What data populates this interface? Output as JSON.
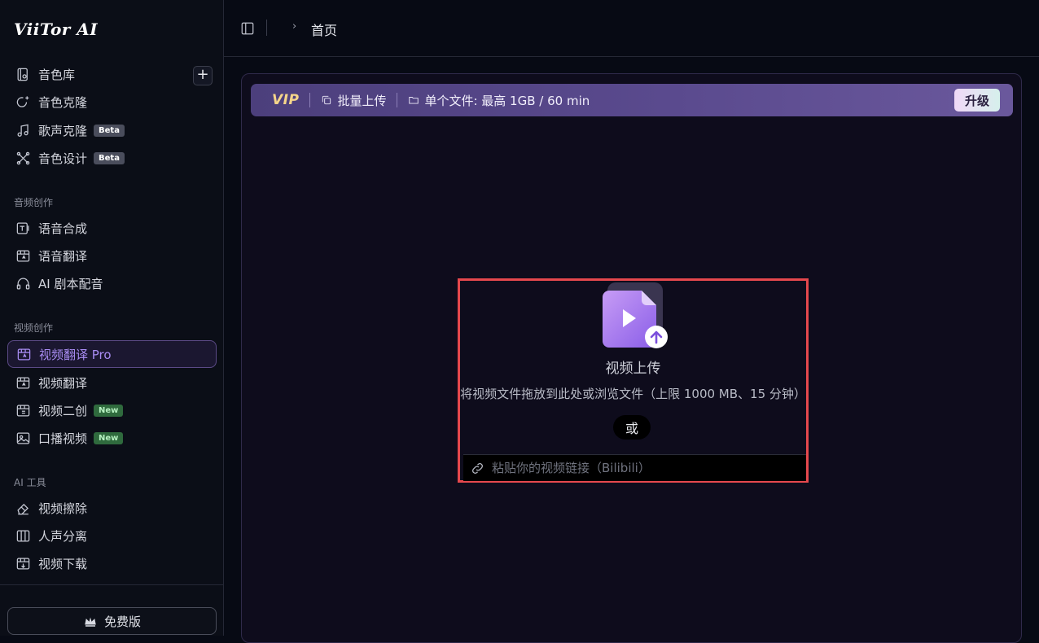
{
  "app": {
    "logo": "ViiTor AI"
  },
  "sidebar": {
    "top_items": [
      {
        "label": "音色库",
        "icon": "voice-library-icon"
      },
      {
        "label": "音色克隆",
        "icon": "voice-clone-icon"
      },
      {
        "label": "歌声克隆",
        "icon": "music-note-icon",
        "badge": "Beta"
      },
      {
        "label": "音色设计",
        "icon": "voice-design-icon",
        "badge": "Beta"
      }
    ],
    "add_label": "+",
    "sections": [
      {
        "title": "音频创作",
        "items": [
          {
            "label": "语音合成",
            "icon": "tts-icon"
          },
          {
            "label": "语音翻译",
            "icon": "speech-translate-icon"
          },
          {
            "label": "AI 剧本配音",
            "icon": "headphones-icon"
          }
        ]
      },
      {
        "title": "视频创作",
        "items": [
          {
            "label": "视频翻译 Pro",
            "icon": "video-translate-icon",
            "active": true
          },
          {
            "label": "视频翻译",
            "icon": "video-translate-icon"
          },
          {
            "label": "视频二创",
            "icon": "video-remix-icon",
            "badge": "New"
          },
          {
            "label": "口播视频",
            "icon": "image-icon",
            "badge": "New"
          }
        ]
      },
      {
        "title": "AI 工具",
        "items": [
          {
            "label": "视频擦除",
            "icon": "eraser-icon"
          },
          {
            "label": "人声分离",
            "icon": "vocal-separation-icon"
          },
          {
            "label": "视频下载",
            "icon": "video-download-icon"
          }
        ]
      }
    ],
    "plan_button": "免费版"
  },
  "topbar": {
    "breadcrumb": "首页"
  },
  "vip_bar": {
    "logo": "VIP",
    "batch_upload": "批量上传",
    "file_limit": "单个文件: 最高 1GB / 60 min",
    "upgrade": "升级"
  },
  "upload": {
    "title": "视频上传",
    "description": "将视频文件拖放到此处或浏览文件（上限 1000 MB、15 分钟）",
    "or": "或",
    "url_placeholder": "粘贴你的视频链接（Bilibili）",
    "url_value": ""
  },
  "colors": {
    "accent": "#a88cf2",
    "highlight_border": "#e5484d",
    "vip_gold": "#f5d58a"
  }
}
